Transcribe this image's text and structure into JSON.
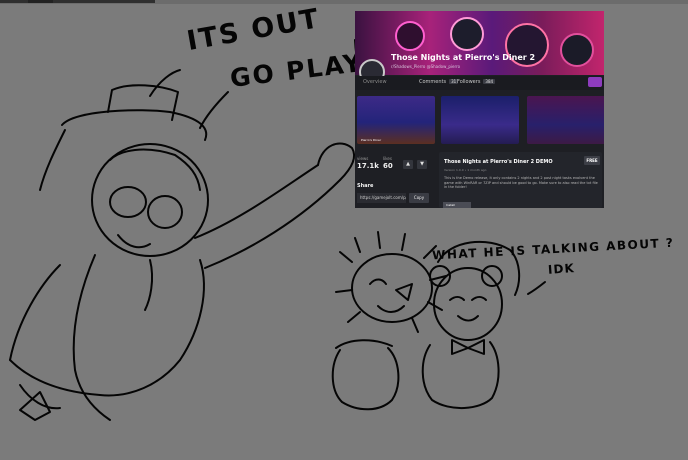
{
  "doodle": {
    "caption_line1": "ITS OUT",
    "caption_line2": "GO PLAY",
    "question": "WHAT HE IS TALKING ABOUT ?",
    "reply": "IDK"
  },
  "embedded_page": {
    "title": "Those Nights at Pierro's Diner 2",
    "subtitle": "r/Shadows_Pierro @Shadow_pierro",
    "tabs": [
      {
        "label": "Overview",
        "count": ""
      },
      {
        "label": "Comments",
        "count": "31"
      },
      {
        "label": "Followers",
        "count": "384"
      }
    ],
    "thumbnails": [
      {
        "label": "Pierro's Diner"
      },
      {
        "label": ""
      },
      {
        "label": ""
      }
    ],
    "stats": {
      "views_label": "views",
      "views_value": "17.1k",
      "likes_label": "likes",
      "likes_value": "60"
    },
    "share": {
      "label": "Share",
      "url": "https://gamejolt.com/p/",
      "copy_label": "Copy"
    },
    "game_card": {
      "title": "Those Nights at Pierro's Diner 2 DEMO",
      "meta": "Version 1.0.0  •  1 month ago",
      "description": "This is the Demo release, it only contains 2 nights and 2 post night tasks evolvent the game with WinRAR or 7ZIP and should be good to go. Make sure to also read the txt file in the folder!",
      "badge": "FREE",
      "install_label": "Install"
    },
    "colors": {
      "accent": "#8e3cbe",
      "background": "#1e1f24",
      "banner_pink": "#c2256d"
    }
  }
}
